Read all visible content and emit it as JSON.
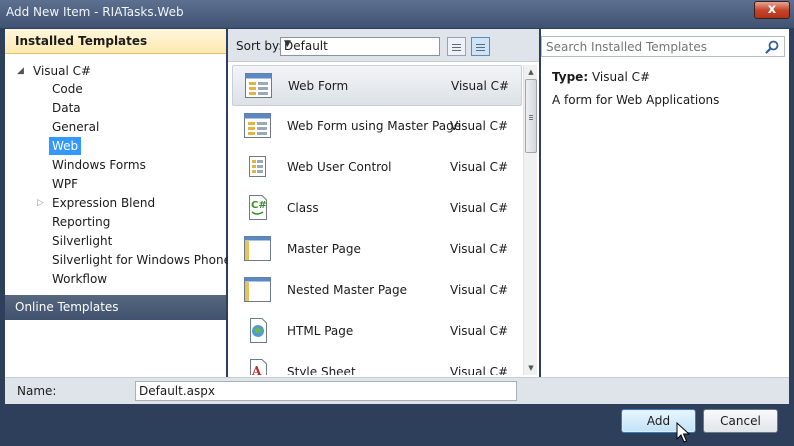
{
  "window": {
    "title": "Add New Item - RIATasks.Web",
    "close_label": "x"
  },
  "left_panel": {
    "installed_header": "Installed Templates",
    "tree": {
      "root": "Visual C#",
      "children": [
        "Code",
        "Data",
        "General",
        "Web",
        "Windows Forms",
        "WPF",
        "Expression Blend",
        "Reporting",
        "Silverlight",
        "Silverlight for Windows Phone",
        "Workflow"
      ],
      "selected": "Web"
    },
    "online_header": "Online Templates"
  },
  "sort": {
    "label": "Sort by:",
    "value": "Default"
  },
  "templates": [
    {
      "name": "Web Form",
      "lang": "Visual C#",
      "icon": "web-form-icon"
    },
    {
      "name": "Web Form using Master Page",
      "lang": "Visual C#",
      "icon": "web-form-master-icon"
    },
    {
      "name": "Web User Control",
      "lang": "Visual C#",
      "icon": "user-control-icon"
    },
    {
      "name": "Class",
      "lang": "Visual C#",
      "icon": "class-file-icon"
    },
    {
      "name": "Master Page",
      "lang": "Visual C#",
      "icon": "master-page-icon"
    },
    {
      "name": "Nested Master Page",
      "lang": "Visual C#",
      "icon": "nested-master-page-icon"
    },
    {
      "name": "HTML Page",
      "lang": "Visual C#",
      "icon": "html-page-icon"
    },
    {
      "name": "Style Sheet",
      "lang": "Visual C#",
      "icon": "style-sheet-icon"
    }
  ],
  "search": {
    "placeholder": "Search Installed Templates"
  },
  "details": {
    "type_label": "Type:",
    "type_value": "Visual C#",
    "description": "A form for Web Applications"
  },
  "name_field": {
    "label": "Name:",
    "value": "Default.aspx"
  },
  "buttons": {
    "add": "Add",
    "cancel": "Cancel"
  }
}
